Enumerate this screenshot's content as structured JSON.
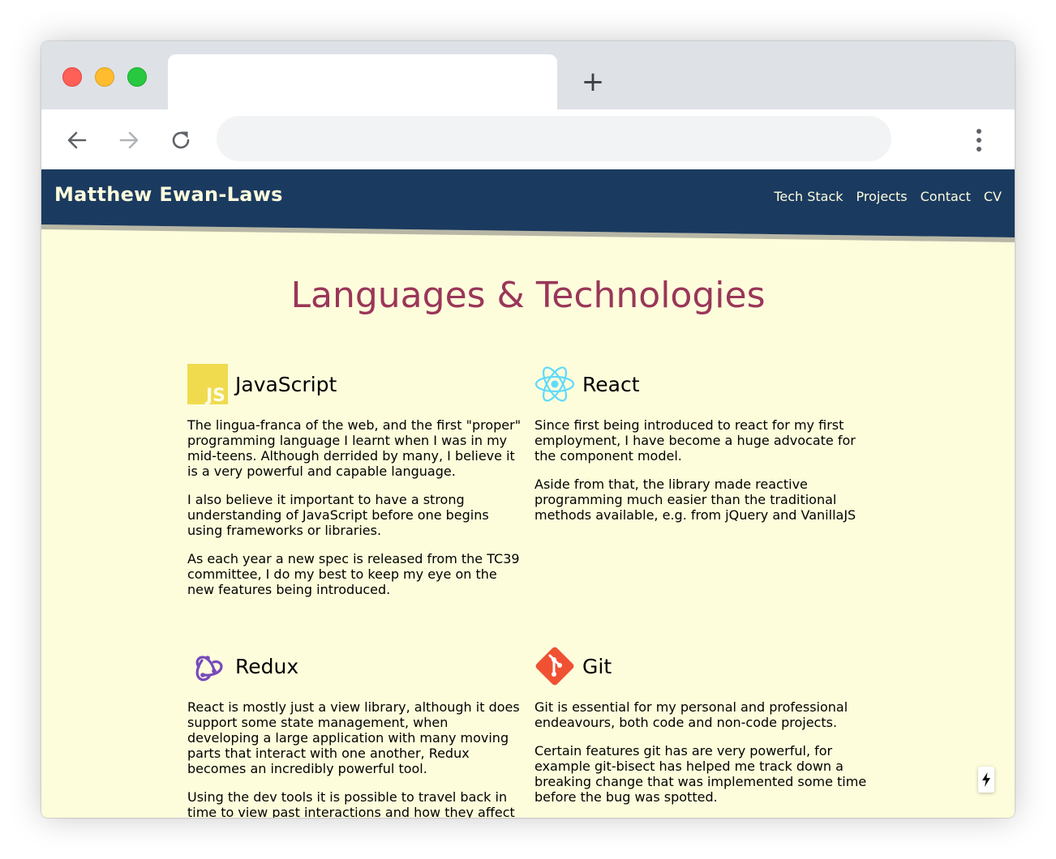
{
  "browser": {
    "tab_title": "",
    "new_tab_glyph": "+",
    "address": "",
    "icons": [
      "back-arrow-icon",
      "forward-arrow-icon",
      "reload-icon",
      "kebab-menu-icon"
    ]
  },
  "site": {
    "brand": "Matthew Ewan-Laws",
    "nav": [
      "Tech Stack",
      "Projects",
      "Contact",
      "CV"
    ],
    "colors": {
      "header_bg": "#1b3a5f",
      "page_bg": "#fdfddc",
      "heading": "#9a3659",
      "header_text": "#fdfddc"
    }
  },
  "main": {
    "heading": "Languages & Technologies",
    "cards": [
      {
        "icon": "javascript-logo-icon",
        "icon_text": "JS",
        "title": "JavaScript",
        "paragraphs": [
          "The lingua-franca of the web, and the first \"proper\" programming language I learnt when I was in my mid-teens. Although derrided by many, I believe it is a very powerful and capable language.",
          "I also believe it important to have a strong understanding of JavaScript before one begins using frameworks or libraries.",
          "As each year a new spec is released from the TC39 committee, I do my best to keep my eye on the new features being introduced."
        ]
      },
      {
        "icon": "react-logo-icon",
        "title": "React",
        "paragraphs": [
          "Since first being introduced to react for my first employment, I have become a huge advocate for the component model.",
          "Aside from that, the library made reactive programming much easier than the traditional methods available, e.g. from jQuery and VanillaJS"
        ]
      },
      {
        "icon": "redux-logo-icon",
        "title": "Redux",
        "paragraphs": [
          "React is mostly just a view library, although it does support some state management, when developing a large application with many moving parts that interact with one another, Redux becomes an incredibly powerful tool.",
          "Using the dev tools it is possible to travel back in time to view past interactions and how they affect"
        ]
      },
      {
        "icon": "git-logo-icon",
        "title": "Git",
        "paragraphs": [
          "Git is essential for my personal and professional endeavours, both code and non-code projects.",
          "Certain features git has are very powerful, for example git-bisect has helped me track down a breaking change that was implemented some time before the bug was spotted."
        ]
      }
    ]
  },
  "floating_button": {
    "icon": "lightning-bolt-icon"
  }
}
